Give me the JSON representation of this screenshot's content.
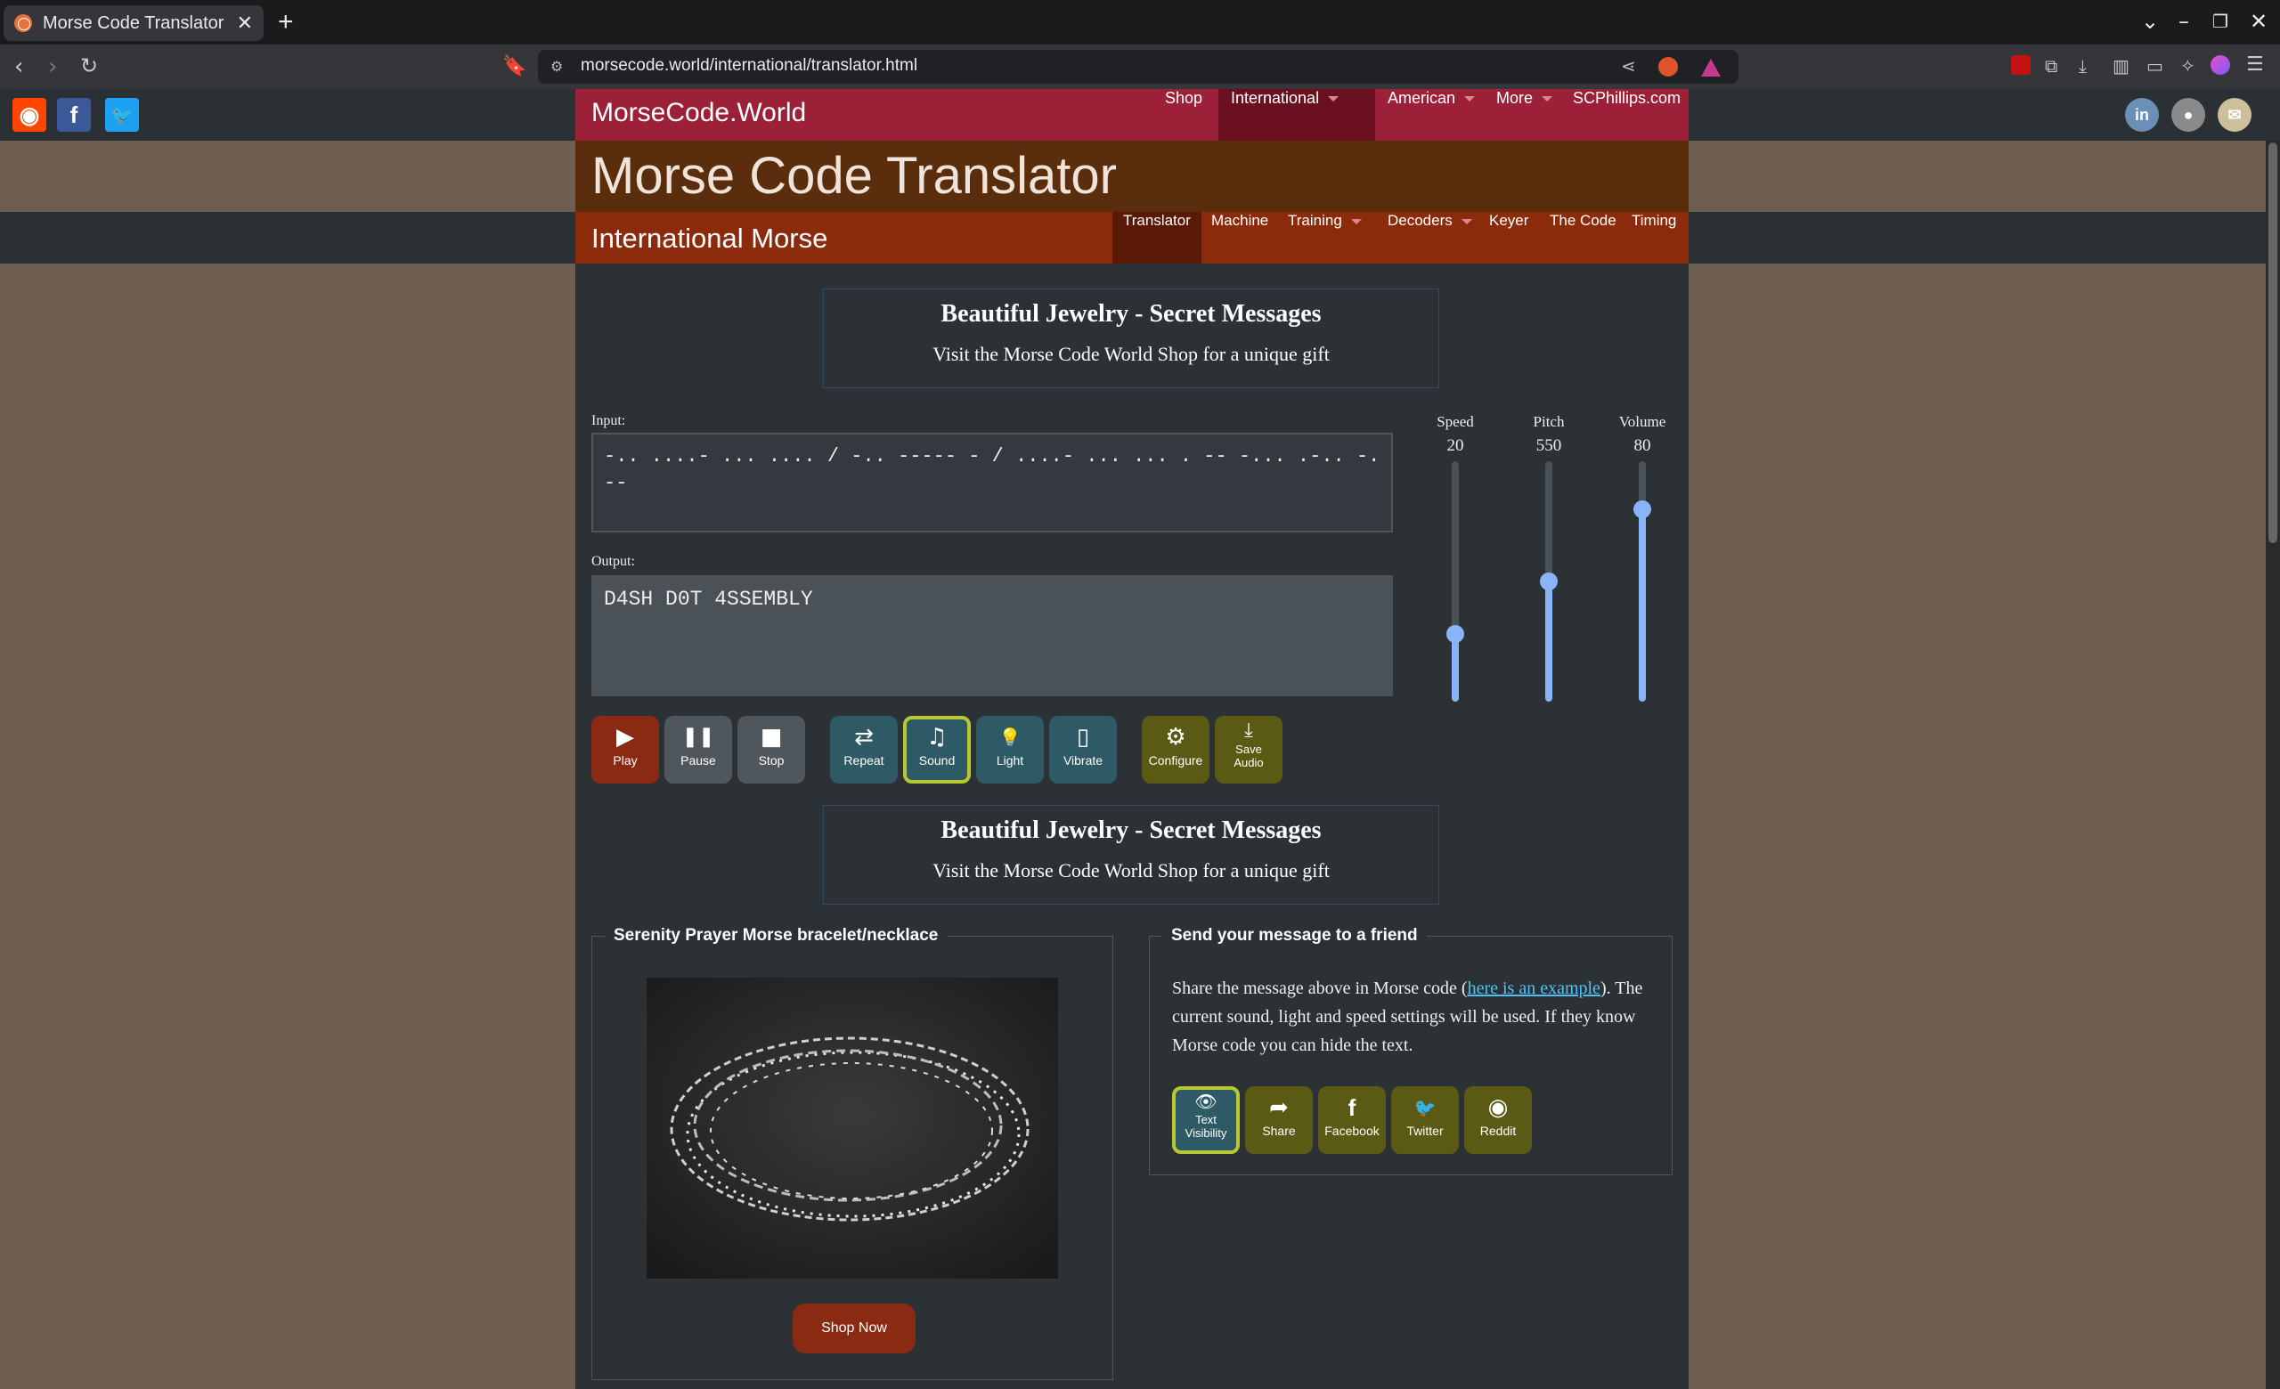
{
  "browser": {
    "tab_title": "Morse Code Translator | I",
    "url": "morsecode.world/international/translator.html"
  },
  "site": {
    "brand": "MorseCode.World",
    "main_nav": [
      {
        "label": "Shop",
        "dropdown": false,
        "active": false
      },
      {
        "label": "International",
        "dropdown": true,
        "active": true
      },
      {
        "label": "American",
        "dropdown": true,
        "active": false
      },
      {
        "label": "More",
        "dropdown": true,
        "active": false
      },
      {
        "label": "SCPhillips.com",
        "dropdown": false,
        "active": false
      }
    ],
    "page_title": "Morse Code Translator",
    "section_title": "International Morse",
    "sub_nav": [
      {
        "label": "Translator",
        "dropdown": false,
        "active": true
      },
      {
        "label": "Machine",
        "dropdown": false,
        "active": false
      },
      {
        "label": "Training",
        "dropdown": true,
        "active": false
      },
      {
        "label": "Decoders",
        "dropdown": true,
        "active": false
      },
      {
        "label": "Keyer",
        "dropdown": false,
        "active": false
      },
      {
        "label": "The Code",
        "dropdown": false,
        "active": false
      },
      {
        "label": "Timing",
        "dropdown": false,
        "active": false
      }
    ]
  },
  "ads": [
    {
      "title": "Beautiful Jewelry - Secret Messages",
      "text": "Visit the Morse Code World Shop for a unique gift"
    },
    {
      "title": "Beautiful Jewelry - Secret Messages",
      "text": "Visit the Morse Code World Shop for a unique gift"
    }
  ],
  "translator": {
    "input_label": "Input:",
    "input_value": "-.. ....- ... .... / -.. ----- - / ....- ... ... . -- -... .-.. -.--",
    "output_label": "Output:",
    "output_value": "D4SH D0T 4SSEMBLY"
  },
  "sliders": [
    {
      "label": "Speed",
      "value": "20",
      "level": 0.28
    },
    {
      "label": "Pitch",
      "value": "550",
      "level": 0.5
    },
    {
      "label": "Volume",
      "value": "80",
      "level": 0.8
    }
  ],
  "controls": [
    {
      "label": "Play",
      "icon": "play-icon",
      "glyph": "▶"
    },
    {
      "label": "Pause",
      "icon": "pause-icon",
      "glyph": "❚❚"
    },
    {
      "label": "Stop",
      "icon": "stop-icon",
      "glyph": "■"
    },
    {
      "label": "Repeat",
      "icon": "repeat-icon",
      "glyph": "⇄"
    },
    {
      "label": "Sound",
      "icon": "music-note-icon",
      "glyph": "♫",
      "selected": true
    },
    {
      "label": "Light",
      "icon": "lightbulb-icon",
      "glyph": "💡"
    },
    {
      "label": "Vibrate",
      "icon": "vibrate-icon",
      "glyph": "▯"
    },
    {
      "label": "Configure",
      "icon": "gear-icon",
      "glyph": "⚙"
    },
    {
      "label": "Save Audio",
      "icon": "download-icon",
      "glyph": "⤓"
    }
  ],
  "product": {
    "legend": "Serenity Prayer Morse bracelet/necklace",
    "button": "Shop Now"
  },
  "share": {
    "legend": "Send your message to a friend",
    "text_before": "Share the message above in Morse code (",
    "link": "here is an example",
    "text_after": "). The current sound, light and speed settings will be used. If they know Morse code you can hide the text.",
    "buttons": [
      {
        "label": "Text Visibility",
        "icon": "eye-icon",
        "glyph": "👁",
        "selected": true
      },
      {
        "label": "Share",
        "icon": "share-icon",
        "glyph": "➦"
      },
      {
        "label": "Facebook",
        "icon": "facebook-icon",
        "glyph": "f"
      },
      {
        "label": "Twitter",
        "icon": "twitter-icon",
        "glyph": "🐦"
      },
      {
        "label": "Reddit",
        "icon": "reddit-icon",
        "glyph": "◉"
      }
    ]
  }
}
